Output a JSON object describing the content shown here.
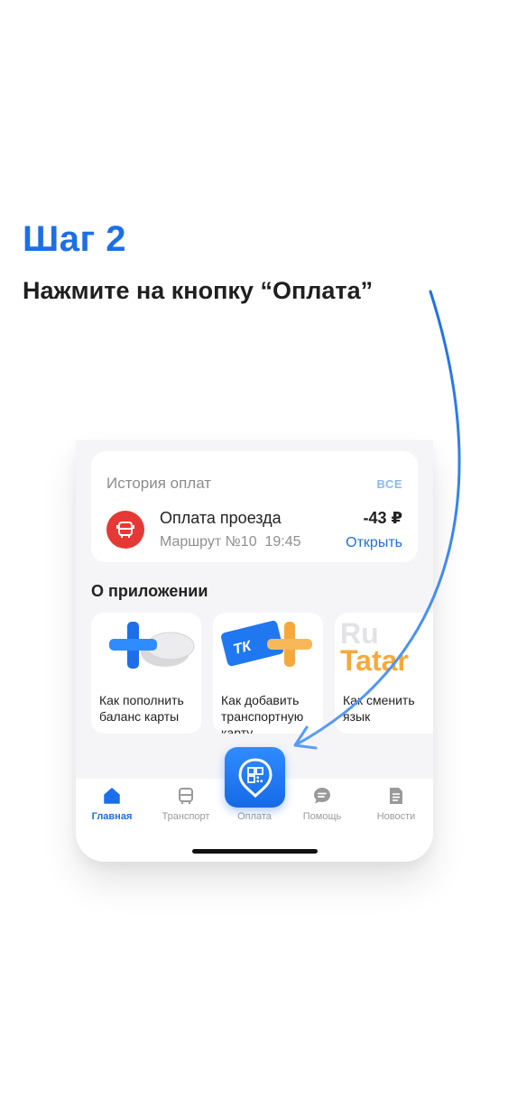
{
  "step": {
    "title": "Шаг 2",
    "text": "Нажмите на кнопку “Оплата”"
  },
  "history": {
    "title": "История оплат",
    "all_label": "ВСЕ",
    "item": {
      "title": "Оплата проезда",
      "subtitle": "Маршрут №10  19:45",
      "amount": "-43 ₽",
      "action": "Открыть"
    }
  },
  "about": {
    "title": "О приложении",
    "tiles": [
      {
        "label": "Как пополнить баланс карты"
      },
      {
        "label": "Как добавить транспортную карту",
        "card_logo": "ТК"
      },
      {
        "label": "Как сменить язык",
        "art_text_top": "Ru",
        "art_text_bottom": "Tatar"
      }
    ]
  },
  "tabs": [
    {
      "label": "Главная",
      "icon": "home-icon"
    },
    {
      "label": "Транспорт",
      "icon": "bus-icon"
    },
    {
      "label": "Оплата",
      "icon": "qr-pin-icon"
    },
    {
      "label": "Помощь",
      "icon": "chat-icon"
    },
    {
      "label": "Новости",
      "icon": "document-icon"
    }
  ],
  "colors": {
    "accent": "#1c6fe8",
    "danger": "#e53935",
    "orange": "#f6a93b",
    "inactive": "#9a9a9a"
  }
}
